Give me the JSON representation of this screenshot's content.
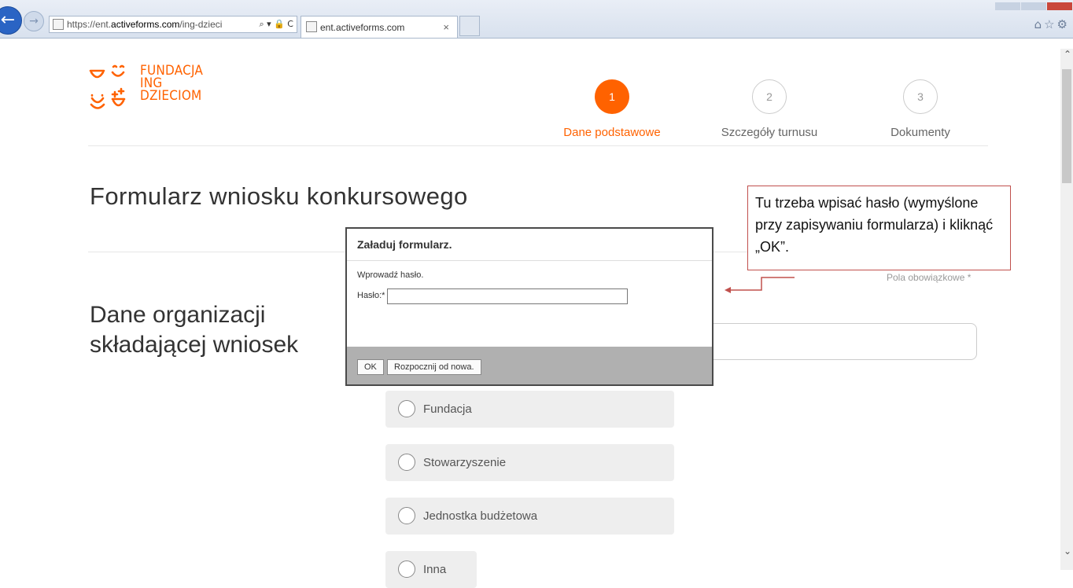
{
  "browser": {
    "url_prefix": "https://ent.",
    "url_domain": "activeforms.com",
    "url_rest": "/ing-dzieci",
    "tab_title": "ent.activeforms.com",
    "tab_close": "×",
    "address_tools": "⌕ ▾ 🔒 C",
    "toolbar_icons": "⌂☆⚙"
  },
  "logo": {
    "line1": "FUNDACJA",
    "line2": "ING",
    "line3": "DZIECIOM",
    "color": "#ff6200"
  },
  "steps": [
    {
      "number": "1",
      "label": "Dane podstawowe",
      "active": true
    },
    {
      "number": "2",
      "label": "Szczegóły turnusu",
      "active": false
    },
    {
      "number": "3",
      "label": "Dokumenty",
      "active": false
    }
  ],
  "page": {
    "form_title": "Formularz wniosku konkursowego",
    "section_title": "Dane organizacji składającej wniosek",
    "required_note": "Pola obowiązkowe *"
  },
  "org_types": [
    "Fundacja",
    "Stowarzyszenie",
    "Jednostka budżetowa",
    "Inna"
  ],
  "modal": {
    "title": "Załaduj formularz.",
    "prompt": "Wprowadź hasło.",
    "password_label": "Hasło:*",
    "password_value": "",
    "ok_label": "OK",
    "restart_label": "Rozpocznij od nowa."
  },
  "annotation": {
    "text": "Tu trzeba wpisać hasło (wymyślone przy zapisywaniu formularza) i kliknąć „OK”.",
    "border_color": "#c0504d",
    "arrow_color": "#c0504d"
  },
  "colors": {
    "accent": "#ff6200"
  }
}
